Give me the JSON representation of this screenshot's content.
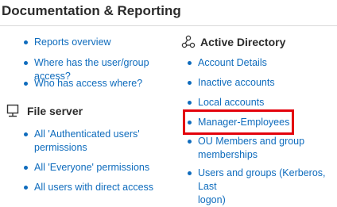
{
  "page": {
    "title": "Documentation & Reporting"
  },
  "left_links": [
    "Reports overview",
    "Where has the user/group access?",
    "Who has access where?"
  ],
  "file_server": {
    "heading": "File server",
    "icon": "file-server-icon",
    "links": [
      "All 'Authenticated users'",
      "permissions",
      "All 'Everyone' permissions",
      "All users with direct access"
    ]
  },
  "active_directory": {
    "heading": "Active Directory",
    "icon": "active-directory-icon",
    "links": [
      "Account Details",
      "Inactive accounts",
      "Local accounts",
      "Manager-Employees",
      "OU Members and group",
      "memberships",
      "Users and groups (Kerberos, Last",
      "logon)"
    ]
  },
  "colors": {
    "link": "#0f6cbd",
    "highlight": "#e3000b"
  }
}
